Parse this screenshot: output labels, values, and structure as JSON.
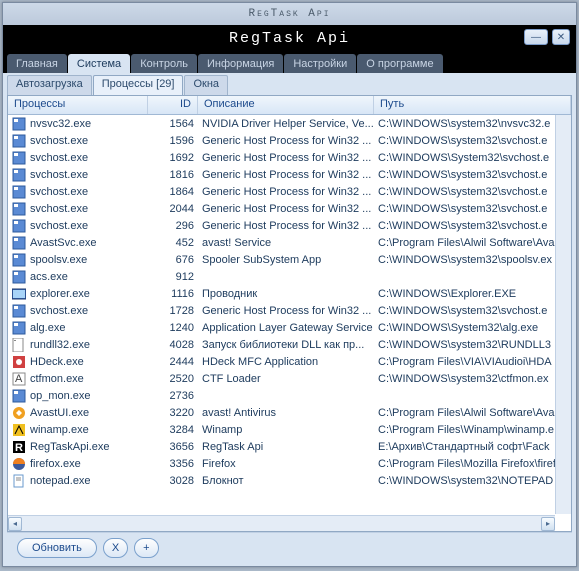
{
  "titlebar": "RegTask Api",
  "inner_title": "RegTask Api",
  "menu": {
    "items": [
      "Главная",
      "Система",
      "Контроль",
      "Информация",
      "Настройки",
      "О программе"
    ],
    "active_index": 1
  },
  "subtabs": {
    "items": [
      "Автозагрузка",
      "Процессы [29]",
      "Окна"
    ],
    "active_index": 1
  },
  "columns": [
    "Процессы",
    "ID",
    "Описание",
    "Путь"
  ],
  "processes": [
    {
      "name": "nvsvc32.exe",
      "id": 1564,
      "desc": "NVIDIA Driver Helper Service, Ve...",
      "path": "C:\\WINDOWS\\system32\\nvsvc32.e",
      "icon": "exe"
    },
    {
      "name": "svchost.exe",
      "id": 1596,
      "desc": "Generic Host Process for Win32 ...",
      "path": "C:\\WINDOWS\\system32\\svchost.e",
      "icon": "exe"
    },
    {
      "name": "svchost.exe",
      "id": 1692,
      "desc": "Generic Host Process for Win32 ...",
      "path": "C:\\WINDOWS\\System32\\svchost.e",
      "icon": "exe"
    },
    {
      "name": "svchost.exe",
      "id": 1816,
      "desc": "Generic Host Process for Win32 ...",
      "path": "C:\\WINDOWS\\system32\\svchost.e",
      "icon": "exe"
    },
    {
      "name": "svchost.exe",
      "id": 1864,
      "desc": "Generic Host Process for Win32 ...",
      "path": "C:\\WINDOWS\\system32\\svchost.e",
      "icon": "exe"
    },
    {
      "name": "svchost.exe",
      "id": 2044,
      "desc": "Generic Host Process for Win32 ...",
      "path": "C:\\WINDOWS\\system32\\svchost.e",
      "icon": "exe"
    },
    {
      "name": "svchost.exe",
      "id": 296,
      "desc": "Generic Host Process for Win32 ...",
      "path": "C:\\WINDOWS\\system32\\svchost.e",
      "icon": "exe"
    },
    {
      "name": "AvastSvc.exe",
      "id": 452,
      "desc": "avast! Service",
      "path": "C:\\Program Files\\Alwil Software\\Ava",
      "icon": "exe"
    },
    {
      "name": "spoolsv.exe",
      "id": 676,
      "desc": "Spooler SubSystem App",
      "path": "C:\\WINDOWS\\system32\\spoolsv.ex",
      "icon": "exe"
    },
    {
      "name": "acs.exe",
      "id": 912,
      "desc": "",
      "path": "",
      "icon": "exe"
    },
    {
      "name": "explorer.exe",
      "id": 1116,
      "desc": "Проводник",
      "path": "C:\\WINDOWS\\Explorer.EXE",
      "icon": "explorer"
    },
    {
      "name": "svchost.exe",
      "id": 1728,
      "desc": "Generic Host Process for Win32 ...",
      "path": "C:\\WINDOWS\\system32\\svchost.e",
      "icon": "exe"
    },
    {
      "name": "alg.exe",
      "id": 1240,
      "desc": "Application Layer Gateway Service",
      "path": "C:\\WINDOWS\\System32\\alg.exe",
      "icon": "exe"
    },
    {
      "name": "rundll32.exe",
      "id": 4028,
      "desc": "Запуск библиотеки DLL как пр...",
      "path": "C:\\WINDOWS\\system32\\RUNDLL3",
      "icon": "dll"
    },
    {
      "name": "HDeck.exe",
      "id": 2444,
      "desc": "HDeck MFC Application",
      "path": "C:\\Program Files\\VIA\\VIAudioi\\HDA",
      "icon": "hdeck"
    },
    {
      "name": "ctfmon.exe",
      "id": 2520,
      "desc": "CTF Loader",
      "path": "C:\\WINDOWS\\system32\\ctfmon.ex",
      "icon": "ctf"
    },
    {
      "name": "op_mon.exe",
      "id": 2736,
      "desc": "",
      "path": "",
      "icon": "exe"
    },
    {
      "name": "AvastUI.exe",
      "id": 3220,
      "desc": "avast! Antivirus",
      "path": "C:\\Program Files\\Alwil Software\\Ava",
      "icon": "avast"
    },
    {
      "name": "winamp.exe",
      "id": 3284,
      "desc": "Winamp",
      "path": "C:\\Program Files\\Winamp\\winamp.e",
      "icon": "winamp"
    },
    {
      "name": "RegTaskApi.exe",
      "id": 3656,
      "desc": "RegTask Api",
      "path": "E:\\Архив\\Стандартный софт\\Fack",
      "icon": "regtask"
    },
    {
      "name": "firefox.exe",
      "id": 3356,
      "desc": "Firefox",
      "path": "C:\\Program Files\\Mozilla Firefox\\firefo",
      "icon": "firefox"
    },
    {
      "name": "notepad.exe",
      "id": 3028,
      "desc": "Блокнот",
      "path": "C:\\WINDOWS\\system32\\NOTEPAD",
      "icon": "notepad"
    }
  ],
  "buttons": {
    "refresh": "Обновить",
    "kill": "X",
    "new": "+"
  }
}
